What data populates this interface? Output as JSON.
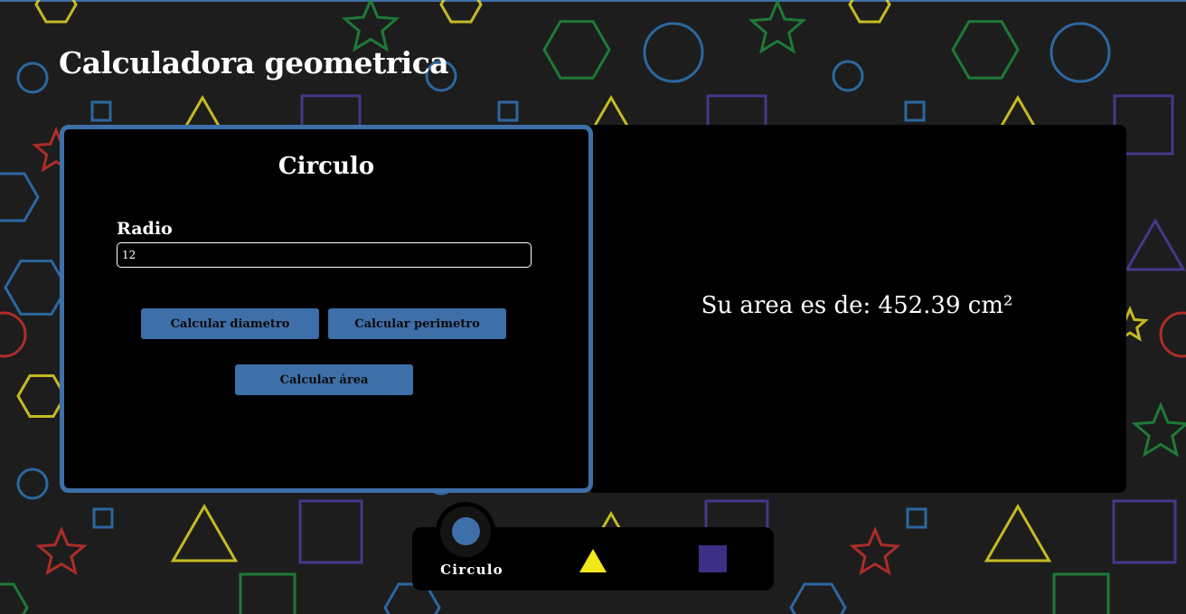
{
  "app": {
    "title": "Calculadora geometrica"
  },
  "calculator": {
    "shape_title": "Circulo",
    "field_label": "Radio",
    "field_value": "12",
    "buttons": {
      "diameter": "Calcular diametro",
      "perimeter": "Calcular perimetro",
      "area": "Calcular área"
    }
  },
  "result": {
    "text": "Su area es de: 452.39 cm²"
  },
  "nav": {
    "items": [
      {
        "label": "Circulo",
        "icon": "circle-icon",
        "active": true
      },
      {
        "label": "",
        "icon": "triangle-icon",
        "active": false
      },
      {
        "label": "",
        "icon": "square-icon",
        "active": false
      }
    ]
  },
  "colors": {
    "accent": "#3e6fa8",
    "background": "#1d1d1d",
    "panel": "#000000",
    "triangle": "#f2e81b",
    "square": "#3b2f86",
    "doodle_blue": "#2f74b6",
    "doodle_green": "#1f8a3c",
    "doodle_yellow": "#e2d626",
    "doodle_red": "#c6302c",
    "doodle_purple": "#4d3c9c"
  }
}
